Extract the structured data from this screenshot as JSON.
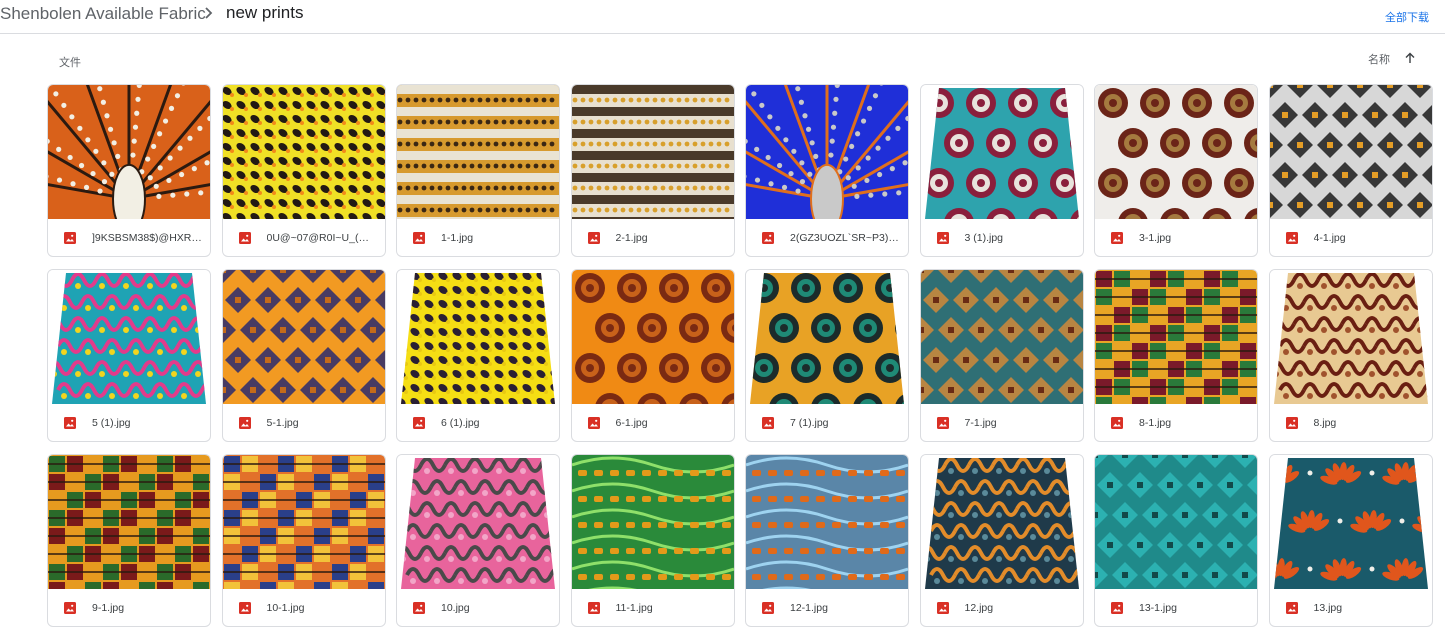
{
  "breadcrumb": {
    "root": "Shenbolen Available Fabric",
    "current": "new prints"
  },
  "actions": {
    "download_all": "全部下载"
  },
  "list_header": {
    "files_label": "文件",
    "sort_label": "名称",
    "sort_direction": "ascending"
  },
  "files": [
    {
      "name": "]9KSBSM38$)@HXR]...",
      "shape": "rect",
      "bg": "#d9611a",
      "c1": "#2b1a10",
      "c2": "#f2efe4",
      "motif": "rays"
    },
    {
      "name": "0U@~07@R0I~U_(D8...",
      "shape": "rect",
      "bg": "#f0e026",
      "c1": "#221914",
      "c2": "#f28a1a",
      "motif": "dots"
    },
    {
      "name": "1-1.jpg",
      "shape": "rect",
      "bg": "#d79a2e",
      "c1": "#3a2714",
      "c2": "#e9e3d3",
      "motif": "stripes"
    },
    {
      "name": "2-1.jpg",
      "shape": "rect",
      "bg": "#e8e0cf",
      "c1": "#d8a02c",
      "c2": "#4a3a2a",
      "motif": "stripes"
    },
    {
      "name": "2(GZ3UOZL`SR~P3)1...",
      "shape": "rect",
      "bg": "#1f2fd8",
      "c1": "#e06f1c",
      "c2": "#c9c9c9",
      "motif": "rays"
    },
    {
      "name": "3 (1).jpg",
      "shape": "trap",
      "bg": "#2ea3ad",
      "c1": "#8a1f3c",
      "c2": "#e8e3dc",
      "motif": "circles"
    },
    {
      "name": "3-1.jpg",
      "shape": "rect",
      "bg": "#efedea",
      "c1": "#6b2418",
      "c2": "#a57a3f",
      "motif": "circles"
    },
    {
      "name": "4-1.jpg",
      "shape": "rect",
      "bg": "#d7d7d7",
      "c1": "#1c1c1c",
      "c2": "#e49d26",
      "motif": "diamonds"
    },
    {
      "name": "5 (1).jpg",
      "shape": "trap",
      "bg": "#1fa3b4",
      "c1": "#e23b8b",
      "c2": "#f1d51e",
      "motif": "waves"
    },
    {
      "name": "5-1.jpg",
      "shape": "rect",
      "bg": "#f29a22",
      "c1": "#2a2a6e",
      "c2": "#c46a1a",
      "motif": "diamonds"
    },
    {
      "name": "6 (1).jpg",
      "shape": "trap",
      "bg": "#f5de14",
      "c1": "#2a1f33",
      "c2": "#e8c912",
      "motif": "dots"
    },
    {
      "name": "6-1.jpg",
      "shape": "rect",
      "bg": "#f08a14",
      "c1": "#7a2a12",
      "c2": "#c8621a",
      "motif": "circles"
    },
    {
      "name": "7 (1).jpg",
      "shape": "trap",
      "bg": "#e8a225",
      "c1": "#1c2b2b",
      "c2": "#1f8a76",
      "motif": "circles"
    },
    {
      "name": "7-1.jpg",
      "shape": "rect",
      "bg": "#2f6f75",
      "c1": "#d08a3a",
      "c2": "#6a2a14",
      "motif": "diamonds"
    },
    {
      "name": "8-1.jpg",
      "shape": "rect",
      "bg": "#e8a525",
      "c1": "#7a1a2a",
      "c2": "#2a7a3a",
      "motif": "kente"
    },
    {
      "name": "8.jpg",
      "shape": "trap",
      "bg": "#e8c992",
      "c1": "#6a1f12",
      "c2": "#a0522d",
      "motif": "waves"
    },
    {
      "name": "9-1.jpg",
      "shape": "rect",
      "bg": "#e69a1f",
      "c1": "#2a6a2a",
      "c2": "#7a1a1a",
      "motif": "kente"
    },
    {
      "name": "10-1.jpg",
      "shape": "rect",
      "bg": "#e2712a",
      "c1": "#2a3f8a",
      "c2": "#f2c23a",
      "motif": "kente"
    },
    {
      "name": "10.jpg",
      "shape": "trap",
      "bg": "#e8649c",
      "c1": "#4a4a4a",
      "c2": "#f2a6c8",
      "motif": "waves"
    },
    {
      "name": "11-1.jpg",
      "shape": "rect",
      "bg": "#2a8a3a",
      "c1": "#e39a1a",
      "c2": "#8fe06a",
      "motif": "arcs"
    },
    {
      "name": "12-1.jpg",
      "shape": "rect",
      "bg": "#5a86a8",
      "c1": "#e06a1a",
      "c2": "#9ed3f0",
      "motif": "arcs"
    },
    {
      "name": "12.jpg",
      "shape": "trap",
      "bg": "#1f3a4a",
      "c1": "#e38c2a",
      "c2": "#5a8a9a",
      "motif": "waves"
    },
    {
      "name": "13-1.jpg",
      "shape": "rect",
      "bg": "#1f8a8a",
      "c1": "#2fb7b7",
      "c2": "#124a4a",
      "motif": "diamonds"
    },
    {
      "name": "13.jpg",
      "shape": "trap",
      "bg": "#1a5a6a",
      "c1": "#e0561c",
      "c2": "#f0efe9",
      "motif": "fans"
    }
  ]
}
